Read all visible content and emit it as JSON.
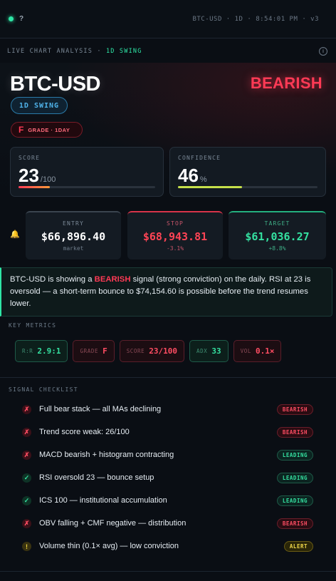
{
  "topbar": {
    "help": "?",
    "status": "BTC-USD · 1D · 8:54:01 PM · v3"
  },
  "strip": {
    "label": "LIVE CHART ANALYSIS",
    "separator": " · ",
    "accent": "1D SWING",
    "info_icon": "i"
  },
  "hero": {
    "ticker": "BTC-USD",
    "signal": "BEARISH",
    "swing_pill": "1D SWING",
    "grade_letter": "F",
    "grade_text": "GRADE · 1DAY"
  },
  "score": {
    "label": "SCORE",
    "value": "23",
    "suffix": "/100",
    "fraction": 0.23,
    "bar_color": "#ff4455"
  },
  "confidence": {
    "label": "CONFIDENCE",
    "value": "46",
    "suffix": "%",
    "fraction": 0.46,
    "bar_color": "#c6e04a"
  },
  "levels": {
    "bell_icon": "bell-icon",
    "entry": {
      "label": "ENTRY",
      "value": "$66,896.40",
      "sub": "market",
      "color": "#ffffff",
      "accent": "#3a444f"
    },
    "stop": {
      "label": "STOP",
      "value": "$68,943.81",
      "sub": "-3.1%",
      "color": "#ff4455",
      "accent": "#d8344a"
    },
    "target": {
      "label": "TARGET",
      "value": "$61,036.27",
      "sub": "+8.8%",
      "color": "#34e0a0",
      "accent": "#23b07e"
    }
  },
  "summary": {
    "pre": "BTC-USD is showing a ",
    "signal": "BEARISH",
    "post": " signal (strong conviction) on the daily. RSI at 23 is oversold — a short-term bounce to $74,154.60 is possible before the trend resumes lower."
  },
  "key_metrics": {
    "title": "KEY METRICS",
    "items": [
      {
        "key": "R:R",
        "value": "2.9:1",
        "tone": "green"
      },
      {
        "key": "GRADE",
        "value": "F",
        "tone": "red"
      },
      {
        "key": "SCORE",
        "value": "23/100",
        "tone": "red"
      },
      {
        "key": "ADX",
        "value": "33",
        "tone": "green"
      },
      {
        "key": "VOL",
        "value": "0.1×",
        "tone": "red"
      }
    ]
  },
  "checklist": {
    "title": "SIGNAL CHECKLIST",
    "items": [
      {
        "icon": "✗",
        "status": "fail",
        "text": "Full bear stack — all MAs declining",
        "tag": "BEARISH"
      },
      {
        "icon": "✗",
        "status": "fail",
        "text": "Trend score weak: 26/100",
        "tag": "BEARISH"
      },
      {
        "icon": "✗",
        "status": "fail",
        "text": "MACD bearish + histogram contracting",
        "tag": "LEADING"
      },
      {
        "icon": "✓",
        "status": "pass",
        "text": "RSI oversold 23 — bounce setup",
        "tag": "LEADING"
      },
      {
        "icon": "✓",
        "status": "pass",
        "text": "ICS 100 — institutional accumulation",
        "tag": "LEADING"
      },
      {
        "icon": "✗",
        "status": "fail",
        "text": "OBV falling + CMF negative — distribution",
        "tag": "BEARISH"
      },
      {
        "icon": "!",
        "status": "warn",
        "text": "Volume thin (0.1× avg) — low conviction",
        "tag": "ALERT"
      }
    ]
  }
}
